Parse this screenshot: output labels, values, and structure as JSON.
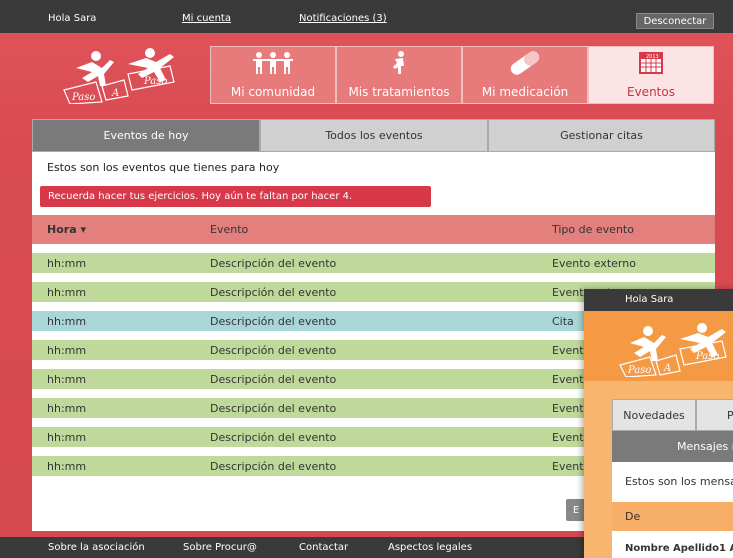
{
  "topbar": {
    "greeting": "Hola Sara",
    "account": "Mi cuenta",
    "notifications": "Notificaciones (3)",
    "logout": "Desconectar"
  },
  "logo": {
    "word1": "Paso",
    "word2": "A",
    "word3": "Paso"
  },
  "nav": [
    {
      "label": "Mi comunidad",
      "icon": "community-icon"
    },
    {
      "label": "Mis tratamientos",
      "icon": "exercise-icon"
    },
    {
      "label": "Mi medicación",
      "icon": "pill-icon"
    },
    {
      "label": "Eventos",
      "icon": "calendar-icon"
    }
  ],
  "calendar_icon_text": "2013",
  "subtabs": [
    "Eventos de hoy",
    "Todos los eventos",
    "Gestionar citas"
  ],
  "intro": "Estos son los eventos que tienes para hoy",
  "alert": "Recuerda hacer tus ejercicios. Hoy aún te faltan por hacer 4.",
  "table": {
    "headers": [
      "Hora ▾",
      "Evento",
      "Tipo de evento"
    ],
    "rows": [
      {
        "time": "hh:mm",
        "event": "Descripción del evento",
        "type": "Evento externo"
      },
      {
        "time": "hh:mm",
        "event": "Descripción del evento",
        "type": "Evento externo"
      },
      {
        "time": "hh:mm",
        "event": "Descripción del evento",
        "type": "Cita"
      },
      {
        "time": "hh:mm",
        "event": "Descripción del evento",
        "type": "Evento externo"
      },
      {
        "time": "hh:mm",
        "event": "Descripción del evento",
        "type": "Evento externo"
      },
      {
        "time": "hh:mm",
        "event": "Descripción del evento",
        "type": "Evento externo"
      },
      {
        "time": "hh:mm",
        "event": "Descripción del evento",
        "type": "Evento externo"
      },
      {
        "time": "hh:mm",
        "event": "Descripción del evento",
        "type": "Evento externo"
      }
    ]
  },
  "more_button": "E",
  "footer": {
    "about": "Sobre la asociación",
    "procura": "Sobre Procur@",
    "contact": "Contactar",
    "legal": "Aspectos legales"
  },
  "overlay": {
    "greeting": "Hola Sara",
    "tab1": "Novedades",
    "tab2": "P",
    "strip": "Mensajes r",
    "msg": "Estos son los mensaje",
    "de": "De",
    "name": "Nombre Apellido1 A"
  },
  "colors": {
    "brand_red": "#d94a52",
    "row_green": "#bfd99b",
    "row_cita": "#a9d6d6",
    "alert": "#d7384a",
    "overlay_orange": "#f49a45"
  }
}
